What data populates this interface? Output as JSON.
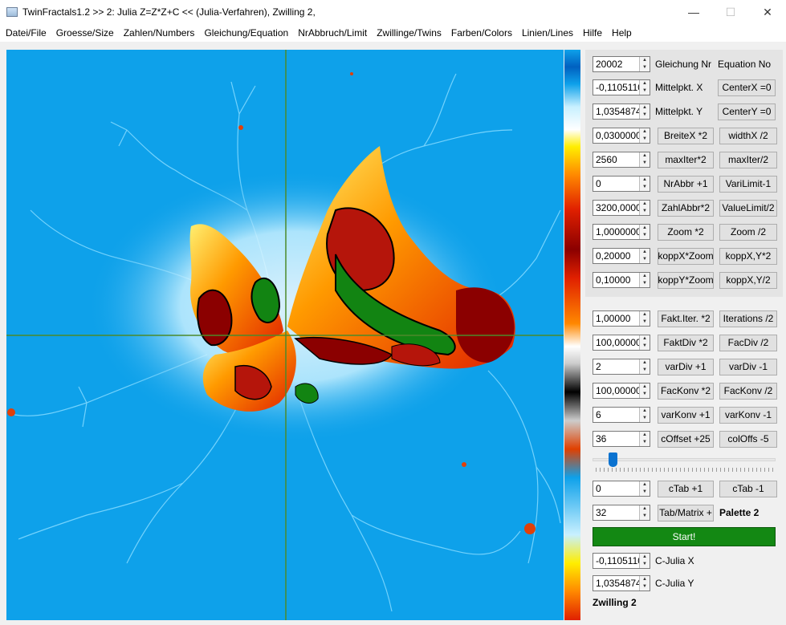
{
  "window": {
    "title": "TwinFractals1.2 >> 2: Julia Z=Z*Z+C << (Julia-Verfahren), Zwilling 2,",
    "minimize": "—",
    "maximize": "☐",
    "close": "✕"
  },
  "menu": [
    "Datei/File",
    "Groesse/Size",
    "Zahlen/Numbers",
    "Gleichung/Equation",
    "NrAbbruch/Limit",
    "Zwillinge/Twins",
    "Farben/Colors",
    "Linien/Lines",
    "Hilfe",
    "Help"
  ],
  "params": [
    {
      "value": "20002",
      "b1": "Gleichung Nr",
      "b2": "Equation No",
      "label_only": true
    },
    {
      "value": "-0,1105110",
      "b1": "Mittelpkt. X",
      "b2": "CenterX =0",
      "first_label": true
    },
    {
      "value": "1,03548740",
      "b1": "Mittelpkt. Y",
      "b2": "CenterY =0",
      "first_label": true
    },
    {
      "value": "0,0300000",
      "b1": "BreiteX *2",
      "b2": "widthX /2"
    },
    {
      "value": "2560",
      "b1": "maxIter*2",
      "b2": "maxIter/2"
    },
    {
      "value": "0",
      "b1": "NrAbbr +1",
      "b2": "VariLimit-1"
    },
    {
      "value": "3200,0000",
      "b1": "ZahlAbbr*2",
      "b2": "ValueLimit/2"
    },
    {
      "value": "1,0000000",
      "b1": "Zoom *2",
      "b2": "Zoom /2"
    },
    {
      "value": "0,20000",
      "b1": "koppX*Zoom",
      "b2": "koppX,Y*2"
    },
    {
      "value": "0,10000",
      "b1": "koppY*Zoom",
      "b2": "koppX,Y/2"
    }
  ],
  "params2": [
    {
      "value": "1,00000",
      "b1": "Fakt.Iter. *2",
      "b2": "Iterations /2"
    },
    {
      "value": "100,00000",
      "b1": "FaktDiv *2",
      "b2": "FacDiv /2"
    },
    {
      "value": "2",
      "b1": "varDiv +1",
      "b2": "varDiv -1"
    },
    {
      "value": "100,00000",
      "b1": "FacKonv *2",
      "b2": "FacKonv /2"
    },
    {
      "value": "6",
      "b1": "varKonv +1",
      "b2": "varKonv -1"
    },
    {
      "value": "36",
      "b1": "cOffset +25",
      "b2": "colOffs -5"
    }
  ],
  "slider": {
    "fraction": 0.09
  },
  "ctab": {
    "value": "0",
    "b1": "cTab +1",
    "b2": "cTab -1"
  },
  "tab": {
    "value": "32",
    "b1": "Tab/Matrix +",
    "label": "Palette 2"
  },
  "start_label": "Start!",
  "cjulia": [
    {
      "value": "-0,1105110",
      "label": "C-Julia X"
    },
    {
      "value": "1,03548740",
      "label": "C-Julia Y"
    }
  ],
  "twin_label": "Zwilling 2",
  "colors": {
    "background": "#0ea1ea",
    "start": "#138813"
  }
}
